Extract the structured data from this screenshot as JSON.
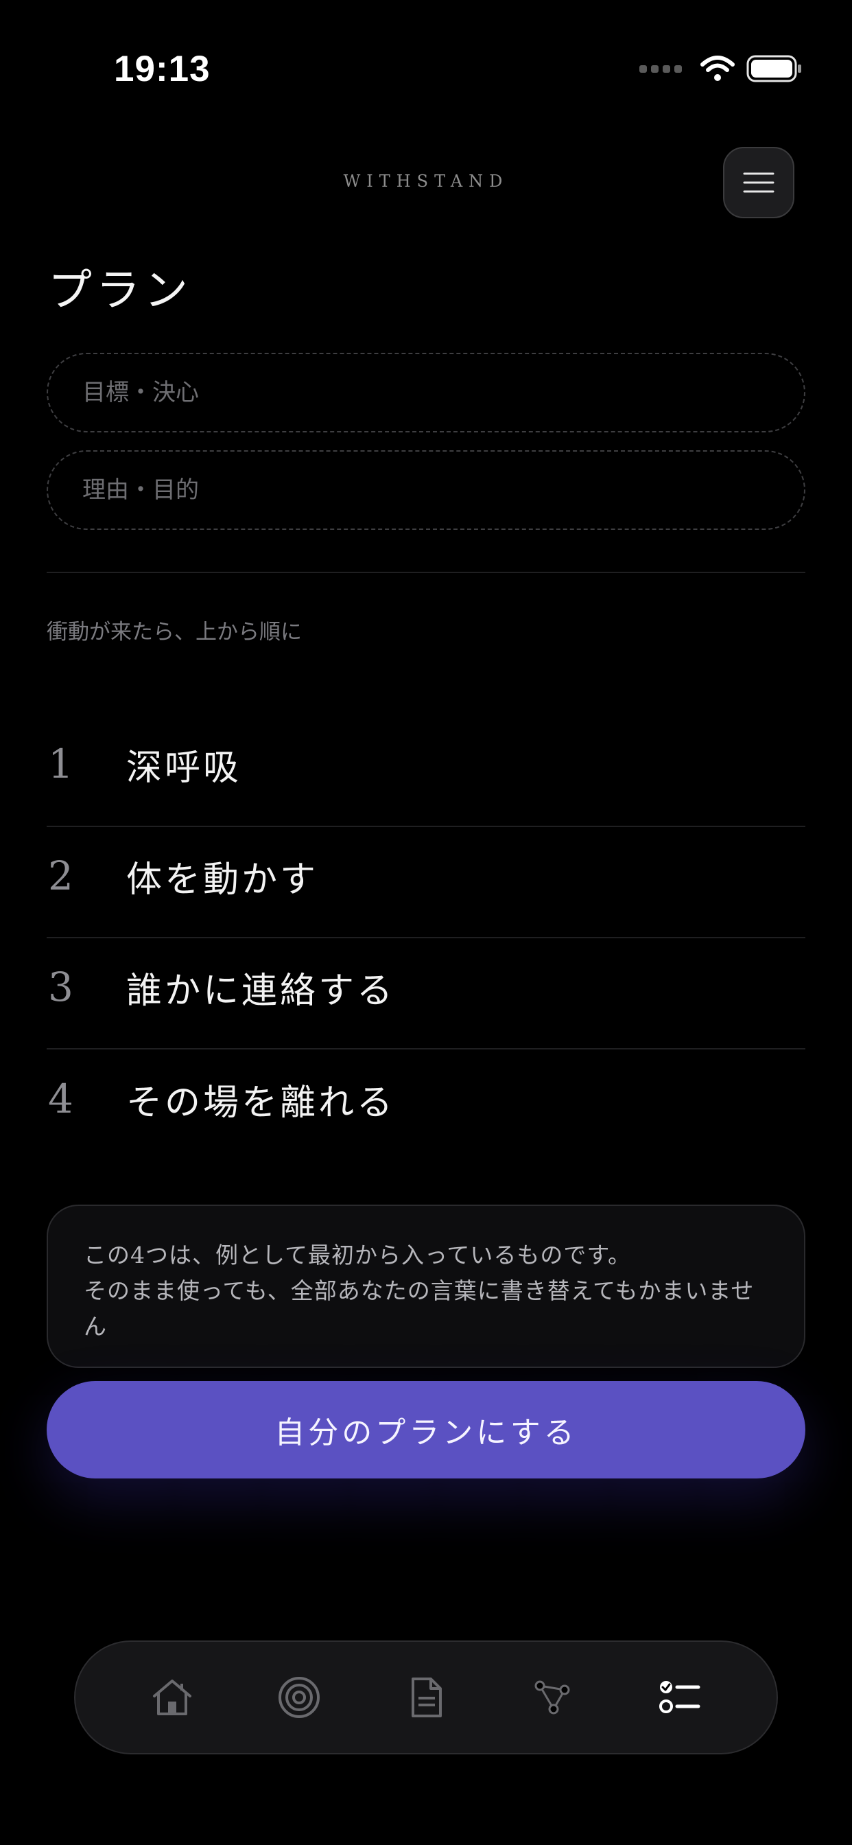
{
  "status_bar": {
    "time": "19:13"
  },
  "header": {
    "brand": "WITHSTAND"
  },
  "page": {
    "title": "プラン"
  },
  "inputs": {
    "goal": {
      "placeholder": "目標・決心",
      "value": ""
    },
    "reason": {
      "placeholder": "理由・目的",
      "value": ""
    }
  },
  "hint": "衝動が来たら、上から順に",
  "steps": [
    {
      "num": "1",
      "label": "深呼吸"
    },
    {
      "num": "2",
      "label": "体を動かす"
    },
    {
      "num": "3",
      "label": "誰かに連絡する"
    },
    {
      "num": "4",
      "label": "その場を離れる"
    }
  ],
  "note": {
    "line1": "この4つは、例として最初から入っているものです。",
    "line2": "そのまま使っても、全部あなたの言葉に書き替えてもかまいません"
  },
  "primary_button": {
    "label": "自分のプランにする"
  },
  "tab_bar": {
    "items": [
      {
        "icon": "home-icon",
        "active": false
      },
      {
        "icon": "target-icon",
        "active": false
      },
      {
        "icon": "document-icon",
        "active": false
      },
      {
        "icon": "network-icon",
        "active": false
      },
      {
        "icon": "checklist-icon",
        "active": true
      }
    ]
  },
  "colors": {
    "background": "#000000",
    "accent": "#5b51c2",
    "muted_text": "#7b7b80",
    "inactive_icon": "#6a6a6e",
    "active_icon": "#ffffff"
  }
}
